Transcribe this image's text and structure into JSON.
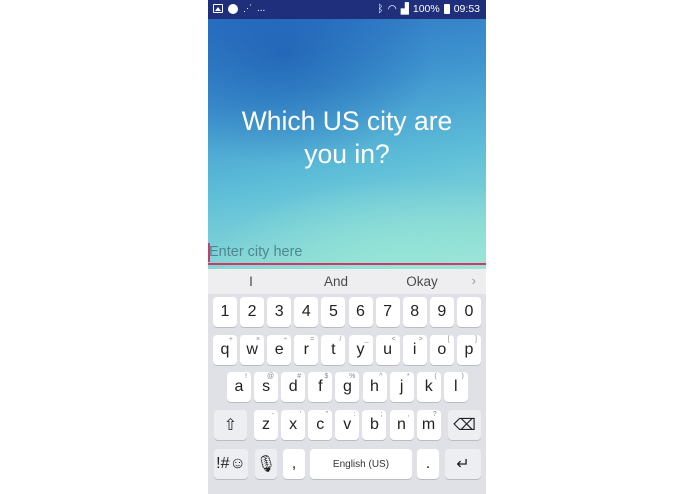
{
  "status_bar": {
    "notification_more": "...",
    "battery_percent": "100%",
    "time": "09:53"
  },
  "hero": {
    "question": "Which US city are you in?"
  },
  "city_input": {
    "value": "",
    "placeholder": "Enter city here"
  },
  "suggestions": {
    "items": [
      "I",
      "And",
      "Okay"
    ],
    "more": "›"
  },
  "keyboard": {
    "numbers": [
      "1",
      "2",
      "3",
      "4",
      "5",
      "6",
      "7",
      "8",
      "9",
      "0"
    ],
    "row1": [
      {
        "key": "q",
        "hint": "+"
      },
      {
        "key": "w",
        "hint": "×"
      },
      {
        "key": "e",
        "hint": "÷"
      },
      {
        "key": "r",
        "hint": "="
      },
      {
        "key": "t",
        "hint": "/"
      },
      {
        "key": "y",
        "hint": "_"
      },
      {
        "key": "u",
        "hint": "<"
      },
      {
        "key": "i",
        "hint": ">"
      },
      {
        "key": "o",
        "hint": "["
      },
      {
        "key": "p",
        "hint": "]"
      }
    ],
    "row2": [
      {
        "key": "a",
        "hint": "!"
      },
      {
        "key": "s",
        "hint": "@"
      },
      {
        "key": "d",
        "hint": "#"
      },
      {
        "key": "f",
        "hint": "$"
      },
      {
        "key": "g",
        "hint": "%"
      },
      {
        "key": "h",
        "hint": "^"
      },
      {
        "key": "j",
        "hint": "*"
      },
      {
        "key": "k",
        "hint": "("
      },
      {
        "key": "l",
        "hint": ")"
      }
    ],
    "row3": [
      {
        "key": "z",
        "hint": "-"
      },
      {
        "key": "x",
        "hint": "'"
      },
      {
        "key": "c",
        "hint": "\""
      },
      {
        "key": "v",
        "hint": ":"
      },
      {
        "key": "b",
        "hint": ";"
      },
      {
        "key": "n",
        "hint": ","
      },
      {
        "key": "m",
        "hint": "?"
      }
    ],
    "shift_icon": "⇧",
    "backspace_icon": "⌫",
    "symbols_label": "!#☺",
    "mic_icon": "🎙",
    "comma": ",",
    "space_label": "English (US)",
    "period": ".",
    "enter_icon": "↵"
  },
  "colors": {
    "status_bar": "#1f2f7c",
    "accent": "#d6356a",
    "keyboard_bg": "#dfe1e6"
  }
}
